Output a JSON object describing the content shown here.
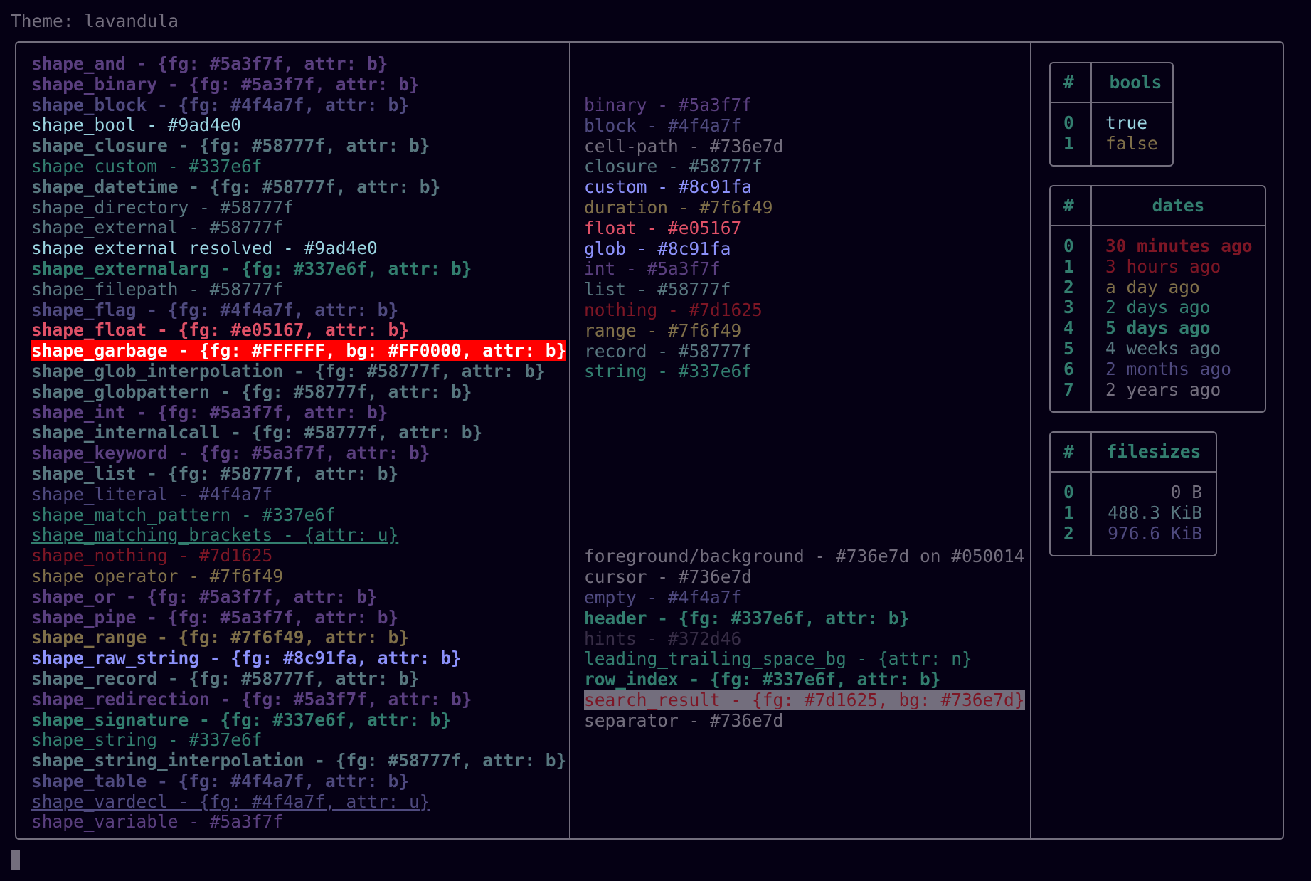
{
  "theme_line": "Theme: lavandula",
  "col1": [
    {
      "text": "shape_and - {fg: #5a3f7f, attr: b}",
      "fg": "#5a3f7f",
      "bold": true
    },
    {
      "text": "shape_binary - {fg: #5a3f7f, attr: b}",
      "fg": "#5a3f7f",
      "bold": true
    },
    {
      "text": "shape_block - {fg: #4f4a7f, attr: b}",
      "fg": "#4f4a7f",
      "bold": true
    },
    {
      "text": "shape_bool - #9ad4e0",
      "fg": "#9ad4e0"
    },
    {
      "text": "shape_closure - {fg: #58777f, attr: b}",
      "fg": "#58777f",
      "bold": true
    },
    {
      "text": "shape_custom - #337e6f",
      "fg": "#337e6f"
    },
    {
      "text": "shape_datetime - {fg: #58777f, attr: b}",
      "fg": "#58777f",
      "bold": true
    },
    {
      "text": "shape_directory - #58777f",
      "fg": "#58777f"
    },
    {
      "text": "shape_external - #58777f",
      "fg": "#58777f"
    },
    {
      "text": "shape_external_resolved - #9ad4e0",
      "fg": "#9ad4e0"
    },
    {
      "text": "shape_externalarg - {fg: #337e6f, attr: b}",
      "fg": "#337e6f",
      "bold": true
    },
    {
      "text": "shape_filepath - #58777f",
      "fg": "#58777f"
    },
    {
      "text": "shape_flag - {fg: #4f4a7f, attr: b}",
      "fg": "#4f4a7f",
      "bold": true
    },
    {
      "text": "shape_float - {fg: #e05167, attr: b}",
      "fg": "#e05167",
      "bold": true
    },
    {
      "text": "shape_garbage - {fg: #FFFFFF, bg: #FF0000, attr: b}",
      "fg": "#FFFFFF",
      "bg": "#FF0000",
      "bold": true
    },
    {
      "text": "shape_glob_interpolation - {fg: #58777f, attr: b}",
      "fg": "#58777f",
      "bold": true
    },
    {
      "text": "shape_globpattern - {fg: #58777f, attr: b}",
      "fg": "#58777f",
      "bold": true
    },
    {
      "text": "shape_int - {fg: #5a3f7f, attr: b}",
      "fg": "#5a3f7f",
      "bold": true
    },
    {
      "text": "shape_internalcall - {fg: #58777f, attr: b}",
      "fg": "#58777f",
      "bold": true
    },
    {
      "text": "shape_keyword - {fg: #5a3f7f, attr: b}",
      "fg": "#5a3f7f",
      "bold": true
    },
    {
      "text": "shape_list - {fg: #58777f, attr: b}",
      "fg": "#58777f",
      "bold": true
    },
    {
      "text": "shape_literal - #4f4a7f",
      "fg": "#4f4a7f"
    },
    {
      "text": "shape_match_pattern - #337e6f",
      "fg": "#337e6f"
    },
    {
      "text": "shape_matching_brackets - {attr: u}",
      "fg": "#337e6f",
      "underline": true
    },
    {
      "text": "shape_nothing - #7d1625",
      "fg": "#7d1625"
    },
    {
      "text": "shape_operator - #7f6f49",
      "fg": "#7f6f49"
    },
    {
      "text": "shape_or - {fg: #5a3f7f, attr: b}",
      "fg": "#5a3f7f",
      "bold": true
    },
    {
      "text": "shape_pipe - {fg: #5a3f7f, attr: b}",
      "fg": "#5a3f7f",
      "bold": true
    },
    {
      "text": "shape_range - {fg: #7f6f49, attr: b}",
      "fg": "#7f6f49",
      "bold": true
    },
    {
      "text": "shape_raw_string - {fg: #8c91fa, attr: b}",
      "fg": "#8c91fa",
      "bold": true
    },
    {
      "text": "shape_record - {fg: #58777f, attr: b}",
      "fg": "#58777f",
      "bold": true
    },
    {
      "text": "shape_redirection - {fg: #5a3f7f, attr: b}",
      "fg": "#5a3f7f",
      "bold": true
    },
    {
      "text": "shape_signature - {fg: #337e6f, attr: b}",
      "fg": "#337e6f",
      "bold": true
    },
    {
      "text": "shape_string - #337e6f",
      "fg": "#337e6f"
    },
    {
      "text": "shape_string_interpolation - {fg: #58777f, attr: b}",
      "fg": "#58777f",
      "bold": true
    },
    {
      "text": "shape_table - {fg: #4f4a7f, attr: b}",
      "fg": "#4f4a7f",
      "bold": true
    },
    {
      "text": "shape_vardecl - {fg: #4f4a7f, attr: u}",
      "fg": "#4f4a7f",
      "underline": true
    },
    {
      "text": "shape_variable - #5a3f7f",
      "fg": "#5a3f7f"
    }
  ],
  "col2_top": [
    {
      "text": "binary - #5a3f7f",
      "fg": "#5a3f7f"
    },
    {
      "text": "block - #4f4a7f",
      "fg": "#4f4a7f"
    },
    {
      "text": "cell-path - #736e7d",
      "fg": "#736e7d"
    },
    {
      "text": "closure - #58777f",
      "fg": "#58777f"
    },
    {
      "text": "custom - #8c91fa",
      "fg": "#8c91fa"
    },
    {
      "text": "duration - #7f6f49",
      "fg": "#7f6f49"
    },
    {
      "text": "float - #e05167",
      "fg": "#e05167"
    },
    {
      "text": "glob - #8c91fa",
      "fg": "#8c91fa"
    },
    {
      "text": "int - #5a3f7f",
      "fg": "#5a3f7f"
    },
    {
      "text": "list - #58777f",
      "fg": "#58777f"
    },
    {
      "text": "nothing - #7d1625",
      "fg": "#7d1625"
    },
    {
      "text": "range - #7f6f49",
      "fg": "#7f6f49"
    },
    {
      "text": "record - #58777f",
      "fg": "#58777f"
    },
    {
      "text": "string - #337e6f",
      "fg": "#337e6f"
    }
  ],
  "col2_bottom": [
    {
      "text": "foreground/background - #736e7d on #050014",
      "fg": "#736e7d"
    },
    {
      "text": "cursor - #736e7d",
      "fg": "#736e7d"
    },
    {
      "text": "empty - #4f4a7f",
      "fg": "#4f4a7f"
    },
    {
      "text": "header - {fg: #337e6f, attr: b}",
      "fg": "#337e6f",
      "bold": true
    },
    {
      "text": "hints - #372d46",
      "fg": "#372d46"
    },
    {
      "text": "leading_trailing_space_bg - {attr: n}",
      "fg": "#337e6f"
    },
    {
      "text": "row_index - {fg: #337e6f, attr: b}",
      "fg": "#337e6f",
      "bold": true
    },
    {
      "text": "search_result - {fg: #7d1625, bg: #736e7d}",
      "fg": "#7d1625",
      "bg": "#736e7d"
    },
    {
      "text": "separator - #736e7d",
      "fg": "#736e7d"
    }
  ],
  "bools": {
    "idx_header": "#",
    "header": "bools",
    "rows": [
      {
        "idx": "0",
        "value": "true",
        "fg": "#9ad4e0"
      },
      {
        "idx": "1",
        "value": "false",
        "fg": "#7f6f49"
      }
    ]
  },
  "dates": {
    "idx_header": "#",
    "header": "dates",
    "rows": [
      {
        "idx": "0",
        "value": "30 minutes ago",
        "fg": "#7d1625",
        "bold": true
      },
      {
        "idx": "1",
        "value": "3 hours ago",
        "fg": "#7d1625"
      },
      {
        "idx": "2",
        "value": "a day ago",
        "fg": "#7f6f49"
      },
      {
        "idx": "3",
        "value": "2 days ago",
        "fg": "#337e6f"
      },
      {
        "idx": "4",
        "value": "5 days ago",
        "fg": "#337e6f",
        "bold": true
      },
      {
        "idx": "5",
        "value": "4 weeks ago",
        "fg": "#58777f"
      },
      {
        "idx": "6",
        "value": "2 months ago",
        "fg": "#4f4a7f"
      },
      {
        "idx": "7",
        "value": "2 years ago",
        "fg": "#736e7d"
      }
    ]
  },
  "filesizes": {
    "idx_header": "#",
    "header": "filesizes",
    "rows": [
      {
        "idx": "0",
        "value": "0 B",
        "fg": "#736e7d"
      },
      {
        "idx": "1",
        "value": "488.3 KiB",
        "fg": "#58777f"
      },
      {
        "idx": "2",
        "value": "976.6 KiB",
        "fg": "#4f4a7f"
      }
    ]
  },
  "colors": {
    "background": "#050014",
    "foreground": "#736e7d",
    "border": "#736e7d",
    "accent": "#337e6f"
  }
}
